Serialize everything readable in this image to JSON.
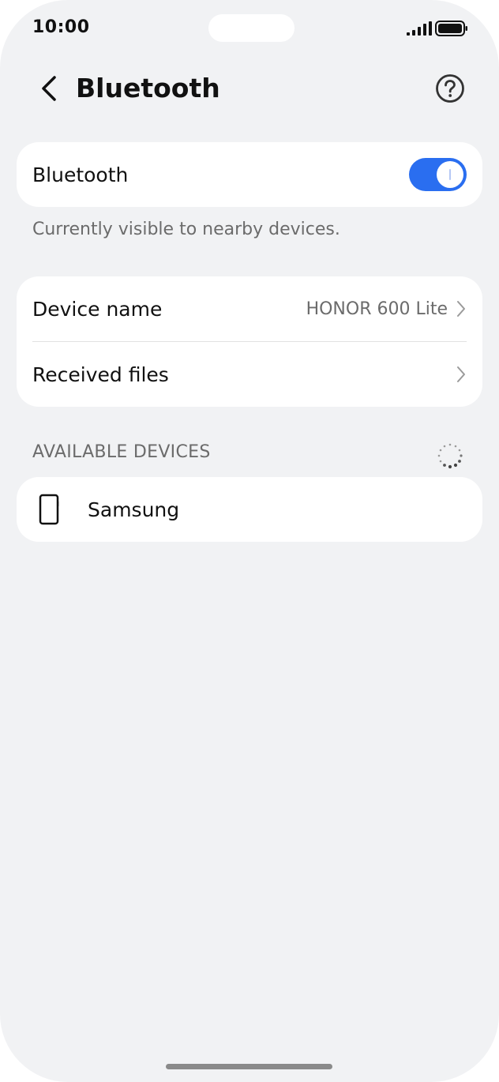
{
  "status_bar": {
    "time": "10:00"
  },
  "header": {
    "title": "Bluetooth",
    "back_icon": "chevron-left-icon",
    "help_icon": "question-circle-icon"
  },
  "bluetooth_card": {
    "label": "Bluetooth",
    "toggle_on": true,
    "accent_color": "#2a6ef0"
  },
  "visibility_text": "Currently visible to nearby devices.",
  "settings_card": {
    "device_name_label": "Device name",
    "device_name_value": "HONOR 600 Lite",
    "received_files_label": "Received files"
  },
  "available_devices": {
    "header": "AVAILABLE DEVICES",
    "items": [
      {
        "name": "Samsung",
        "icon": "phone-icon"
      }
    ]
  }
}
